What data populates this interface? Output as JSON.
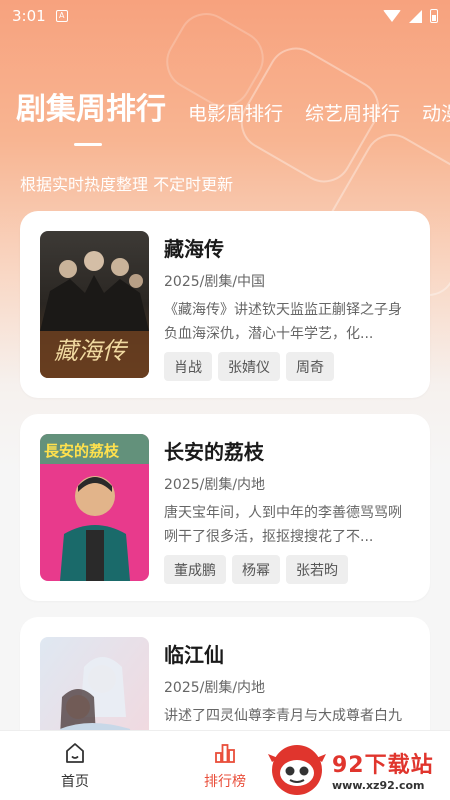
{
  "status_bar": {
    "time": "3:01",
    "notif_letter": "A"
  },
  "tabs": [
    {
      "label": "剧集周排行",
      "active": true
    },
    {
      "label": "电影周排行",
      "active": false
    },
    {
      "label": "综艺周排行",
      "active": false
    },
    {
      "label": "动漫",
      "active": false
    }
  ],
  "subtitle": "根据实时热度整理 不定时更新",
  "items": [
    {
      "title": "藏海传",
      "meta": "2025/剧集/中国",
      "desc": "《藏海传》讲述钦天监监正蒯铎之子身负血海深仇，潜心十年学艺，化...",
      "tags": [
        "肖战",
        "张婧仪",
        "周奇"
      ],
      "poster_text": "藏海传"
    },
    {
      "title": "长安的荔枝",
      "meta": "2025/剧集/内地",
      "desc": "唐天宝年间，人到中年的李善德骂骂咧咧干了很多活，抠抠搜搜花了不...",
      "tags": [
        "董成鹏",
        "杨幂",
        "张若昀"
      ],
      "poster_text": "長安的荔枝"
    },
    {
      "title": "临江仙",
      "meta": "2025/剧集/内地",
      "desc": "讲述了四灵仙尊李青月与大成尊者白九思相爱相杀",
      "tags": [],
      "poster_text": ""
    }
  ],
  "bottom_nav": {
    "home": "首页",
    "ranking": "排行榜"
  },
  "watermark": {
    "title": "92下载站",
    "url": "www.xz92.com"
  },
  "colors": {
    "accent": "#e94e3a",
    "hero_top": "#f7a27e"
  }
}
